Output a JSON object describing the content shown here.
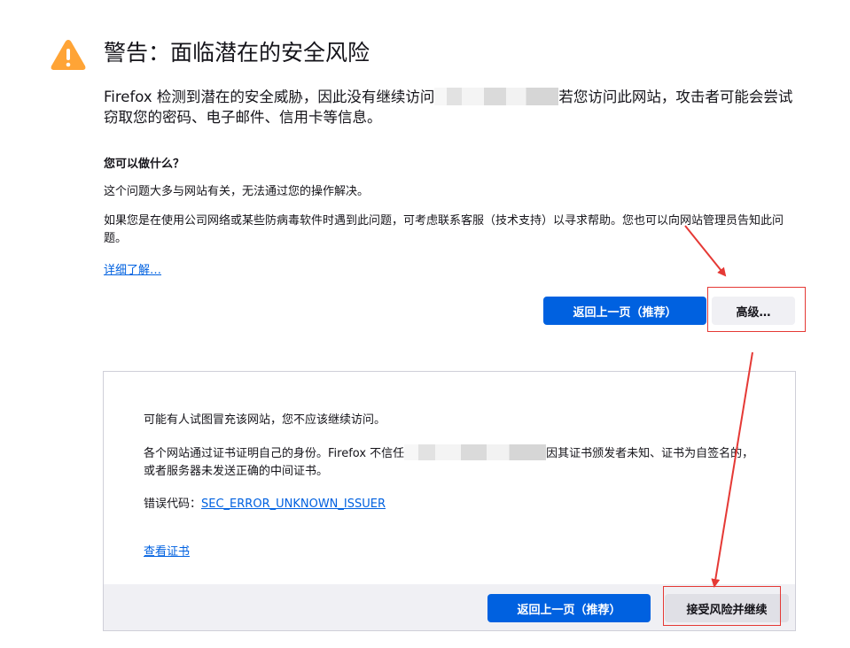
{
  "header": {
    "icon": "warning-triangle-icon",
    "icon_color": "#ffa436",
    "title": "警告：面临潜在的安全风险"
  },
  "intro": {
    "before": "Firefox 检测到潜在的安全威胁，因此没有继续访问",
    "after": "若您访问此网站，攻击者可能会尝试窃取您的密码、电子邮件、信用卡等信息。"
  },
  "what_to_do": {
    "heading": "您可以做什么？",
    "para1": "这个问题大多与网站有关，无法通过您的操作解决。",
    "para2": "如果您是在使用公司网络或某些防病毒软件时遇到此问题，可考虑联系客服（技术支持）以寻求帮助。您也可以向网站管理员告知此问题。",
    "learn_more": "详细了解…"
  },
  "buttons": {
    "go_back": "返回上一页（推荐）",
    "advanced": "高级…"
  },
  "advanced_panel": {
    "line1": "可能有人试图冒充该网站，您不应该继续访问。",
    "line2_before": "各个网站通过证书证明自己的身份。Firefox 不信任",
    "line2_after": "因其证书颁发者未知、证书为自签名的，或者服务器未发送正确的中间证书。",
    "error_label": "错误代码：",
    "error_code": "SEC_ERROR_UNKNOWN_ISSUER",
    "view_cert": "查看证书",
    "go_back": "返回上一页（推荐）",
    "accept": "接受风险并继续"
  },
  "colors": {
    "primary_button": "#0061e0",
    "link": "#0061e0",
    "annotation_red": "#e53935"
  }
}
